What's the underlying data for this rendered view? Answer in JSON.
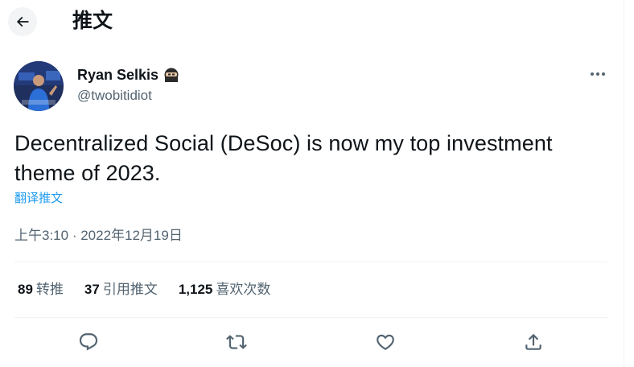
{
  "header": {
    "title": "推文"
  },
  "author": {
    "name": "Ryan Selkis",
    "handle": "@twobitidiot"
  },
  "tweet": {
    "text": "Decentralized Social (DeSoc) is now my top investment theme of 2023.",
    "translate_label": "翻译推文",
    "time": "上午3:10",
    "separator": " · ",
    "date": "2022年12月19日"
  },
  "stats": [
    {
      "count": "89",
      "label": "转推"
    },
    {
      "count": "37",
      "label": "引用推文"
    },
    {
      "count": "1,125",
      "label": "喜欢次数"
    }
  ],
  "icons": {
    "back": "arrow-left-icon",
    "more": "more-icon",
    "emoji": "ninja-emoji",
    "reply": "reply-icon",
    "retweet": "retweet-icon",
    "like": "heart-icon",
    "share": "share-icon"
  },
  "colors": {
    "link": "#1d9bf0",
    "secondary_text": "#536471",
    "text": "#0f1419"
  }
}
